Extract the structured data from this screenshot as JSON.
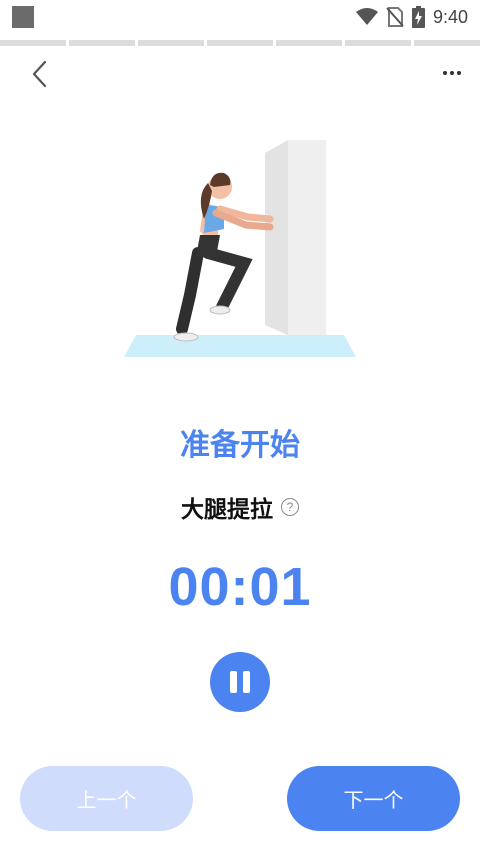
{
  "status_bar": {
    "time": "9:40",
    "icons": [
      "notification-square-icon",
      "wifi-icon",
      "no-sim-icon",
      "battery-charging-icon"
    ]
  },
  "workout_progress": {
    "segments": 7,
    "completed": 0
  },
  "header": {
    "back_icon": "chevron-left-icon",
    "more_icon": "more-dots-icon"
  },
  "exercise": {
    "status_title": "准备开始",
    "name": "大腿提拉",
    "help_icon": "question-circle-icon",
    "help_glyph": "?",
    "timer": "00:01"
  },
  "controls": {
    "pause_icon": "pause-icon",
    "prev_label": "上一个",
    "next_label": "下一个"
  },
  "colors": {
    "accent": "#4b84f0",
    "accent_light": "#cfdcfb",
    "floor": "#cdeffb",
    "wall": "#efefef"
  }
}
